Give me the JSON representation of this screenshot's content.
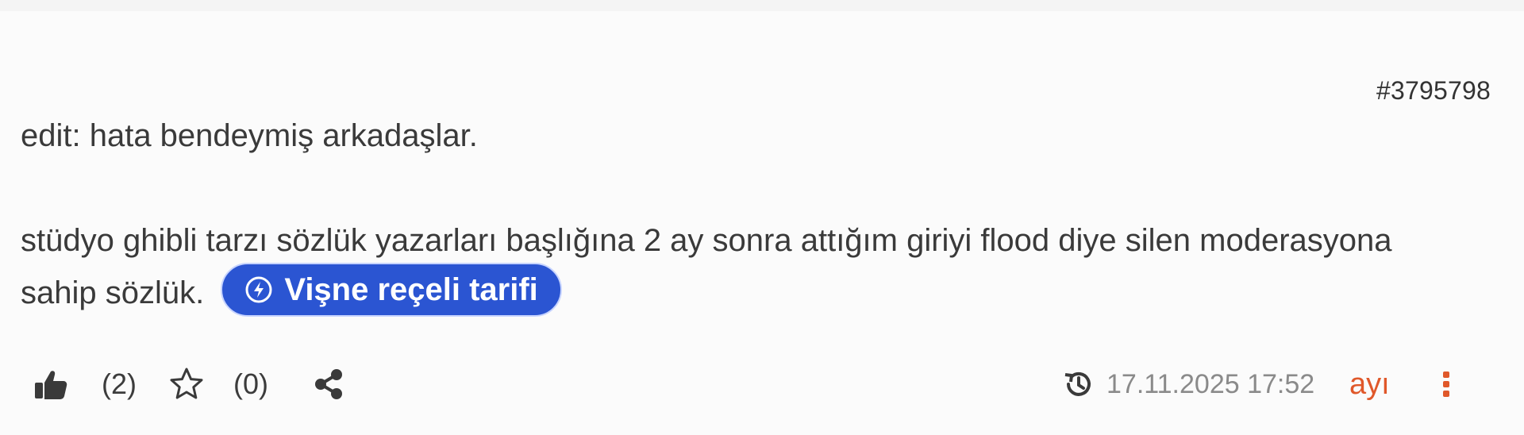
{
  "entry": {
    "id": "#3795798",
    "paragraph1": "edit: hata bendeymiş arkadaşlar.",
    "paragraph2_line1": "stüdyo ghibli tarzı sözlük yazarları başlığına 2 ay sonra attığım giriyi flood diye silen moderasyona",
    "paragraph2_line2": "sahip sözlük.",
    "pill_label": "Vişne reçeli tarifi",
    "colors": {
      "pill": "#2b55d2",
      "author": "#e0582a",
      "date": "#8a8a8a",
      "menu": "#e0582a"
    }
  },
  "footer": {
    "like_count": "(2)",
    "favorite_count": "(0)",
    "timestamp": "17.11.2025 17:52",
    "author": "ayı",
    "icons": [
      "thumbs-up-icon",
      "star-icon",
      "share-icon",
      "history-icon",
      "more-vertical-icon"
    ]
  }
}
